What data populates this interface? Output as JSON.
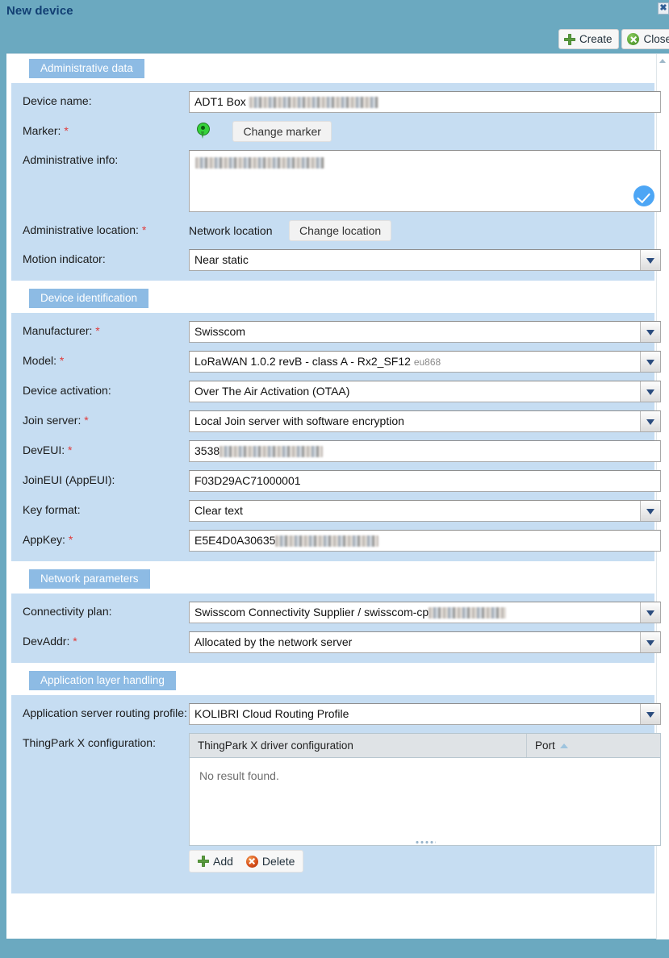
{
  "window": {
    "title": "New device",
    "close_glyph": "✖"
  },
  "toolbar": {
    "create_label": "Create",
    "close_label": "Close"
  },
  "sections": {
    "administrative_data": {
      "heading": "Administrative data",
      "device_name": {
        "label": "Device name:",
        "required": false,
        "value": "ADT1 Box",
        "value_redacted": true
      },
      "marker": {
        "label": "Marker:",
        "required": true,
        "button_label": "Change marker",
        "icon": "map-pin-icon"
      },
      "administrative_info": {
        "label": "Administrative info:",
        "required": false,
        "value": "",
        "value_redacted": true,
        "status_icon": "check-circle-icon"
      },
      "administrative_location": {
        "label": "Administrative location:",
        "required": true,
        "value": "Network location",
        "button_label": "Change location"
      },
      "motion_indicator": {
        "label": "Motion indicator:",
        "required": false,
        "value": "Near static",
        "control": "select"
      }
    },
    "device_identification": {
      "heading": "Device identification",
      "manufacturer": {
        "label": "Manufacturer:",
        "required": true,
        "value": "Swisscom",
        "control": "select"
      },
      "model": {
        "label": "Model:",
        "required": true,
        "value": "LoRaWAN 1.0.2 revB - class A - Rx2_SF12",
        "value_suffix": "eu868",
        "control": "select"
      },
      "device_activation": {
        "label": "Device activation:",
        "required": false,
        "value": "Over The Air Activation (OTAA)",
        "control": "select"
      },
      "join_server": {
        "label": "Join server:",
        "required": true,
        "value": "Local Join server with software encryption",
        "control": "select"
      },
      "dev_eui": {
        "label": "DevEUI:",
        "required": true,
        "value": "3538",
        "value_redacted": true
      },
      "join_eui": {
        "label": "JoinEUI (AppEUI):",
        "required": false,
        "value": "F03D29AC71000001"
      },
      "key_format": {
        "label": "Key format:",
        "required": false,
        "value": "Clear text",
        "control": "select"
      },
      "app_key": {
        "label": "AppKey:",
        "required": true,
        "value": "E5E4D0A30635",
        "value_redacted": true
      }
    },
    "network_parameters": {
      "heading": "Network parameters",
      "connectivity_plan": {
        "label": "Connectivity plan:",
        "required": false,
        "value": "Swisscom Connectivity Supplier / swisscom-cp",
        "value_redacted": true,
        "control": "select"
      },
      "dev_addr": {
        "label": "DevAddr:",
        "required": true,
        "value": "Allocated by the network server",
        "control": "select"
      }
    },
    "application_layer_handling": {
      "heading": "Application layer handling",
      "routing_profile": {
        "label": "Application server routing profile:",
        "required": false,
        "value": "KOLIBRI Cloud Routing Profile",
        "control": "select"
      },
      "thingpark_x_configuration": {
        "label": "ThingPark X configuration:",
        "table": {
          "columns": [
            "ThingPark X driver configuration",
            "Port"
          ],
          "sort_column": "Port",
          "sort_direction": "ascending",
          "rows": [],
          "empty_message": "No result found."
        },
        "add_label": "Add",
        "delete_label": "Delete"
      }
    }
  },
  "colors": {
    "titlebar": "#6ba9c0",
    "panel": "#c6ddf2",
    "section_heading": "#8dbbe4",
    "required_asterisk": "#e03a3a",
    "title_text": "#123f73",
    "check_badge": "#4da6f5"
  }
}
